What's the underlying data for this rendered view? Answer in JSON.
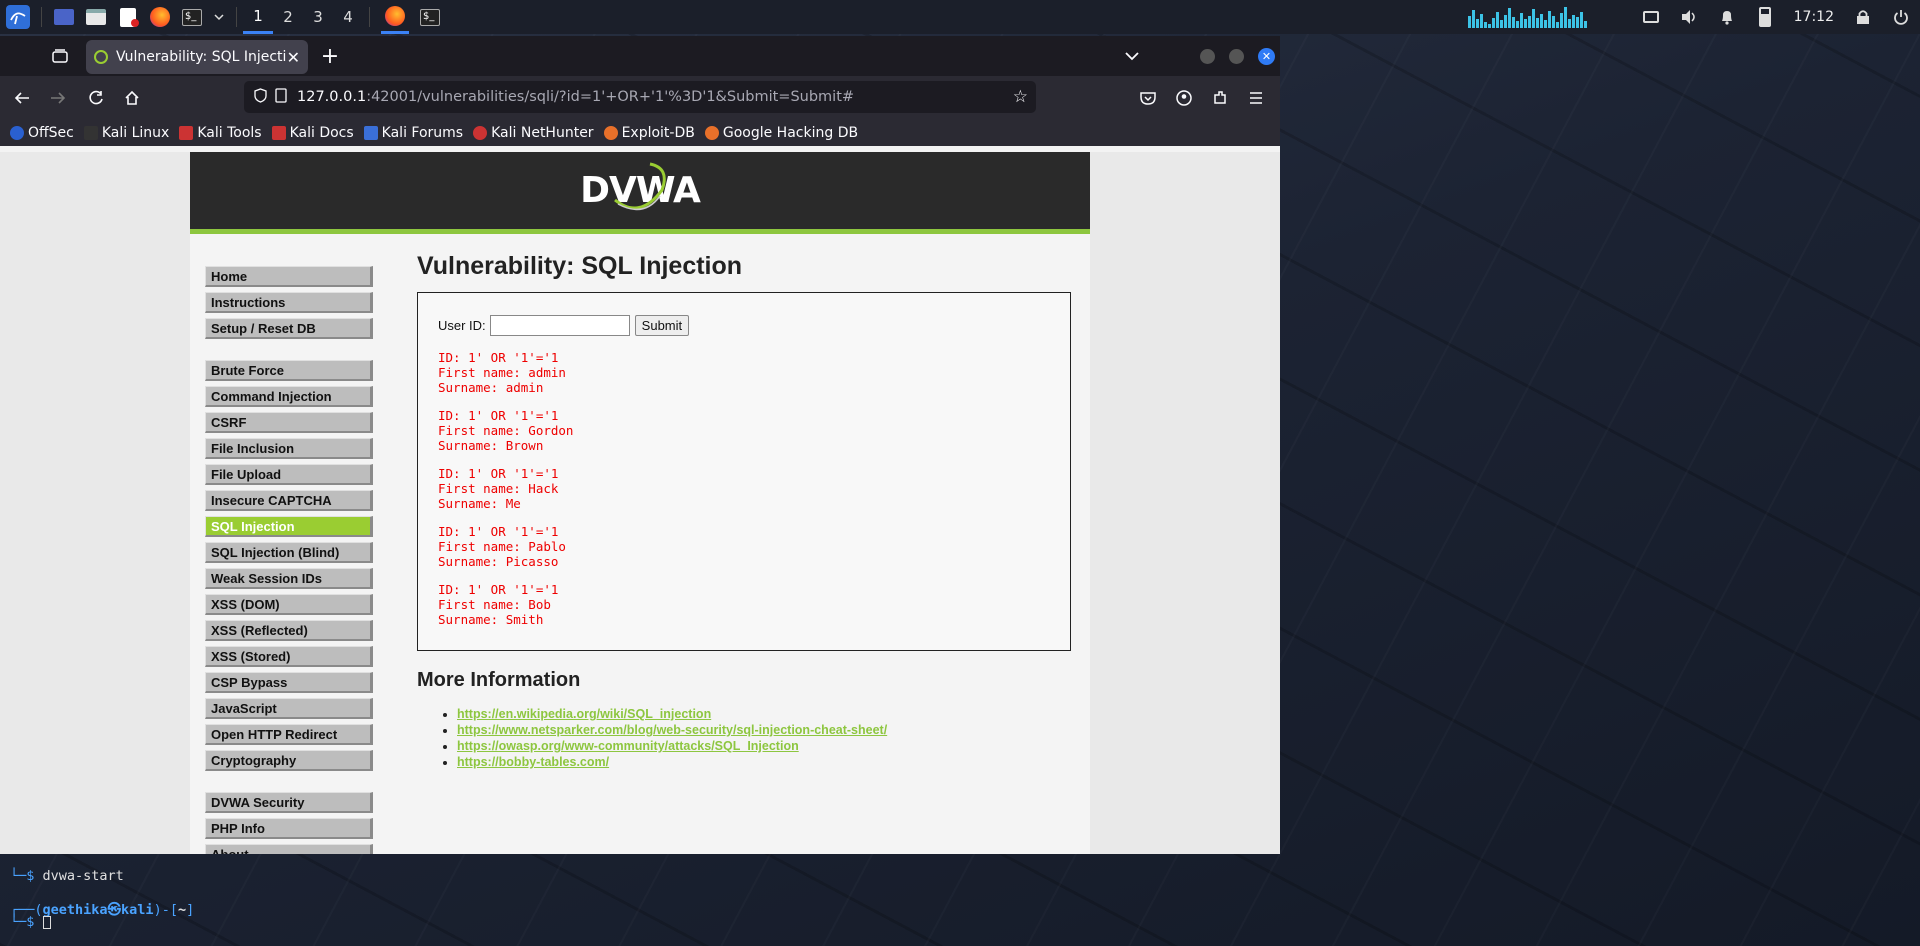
{
  "panel": {
    "workspaces": [
      "1",
      "2",
      "3",
      "4"
    ],
    "active_workspace": "1",
    "clock": "17:12"
  },
  "browser": {
    "tab_title": "Vulnerability: SQL Injection",
    "url_host": "127.0.0.1",
    "url_rest": ":42001/vulnerabilities/sqli/?id=1'+OR+'1'%3D'1&Submit=Submit#",
    "bookmarks": [
      "OffSec",
      "Kali Linux",
      "Kali Tools",
      "Kali Docs",
      "Kali Forums",
      "Kali NetHunter",
      "Exploit-DB",
      "Google Hacking DB"
    ]
  },
  "dvwa": {
    "logo": "DVWA",
    "menu_group1": [
      "Home",
      "Instructions",
      "Setup / Reset DB"
    ],
    "menu_group2": [
      "Brute Force",
      "Command Injection",
      "CSRF",
      "File Inclusion",
      "File Upload",
      "Insecure CAPTCHA",
      "SQL Injection",
      "SQL Injection (Blind)",
      "Weak Session IDs",
      "XSS (DOM)",
      "XSS (Reflected)",
      "XSS (Stored)",
      "CSP Bypass",
      "JavaScript",
      "Open HTTP Redirect",
      "Cryptography"
    ],
    "menu_group3": [
      "DVWA Security",
      "PHP Info",
      "About"
    ],
    "selected_menu": "SQL Injection",
    "title": "Vulnerability: SQL Injection",
    "user_id_label": "User ID:",
    "user_id_value": "",
    "submit_label": "Submit",
    "results": [
      {
        "id": "ID: 1' OR '1'='1",
        "first": "First name: admin",
        "surname": "Surname: admin"
      },
      {
        "id": "ID: 1' OR '1'='1",
        "first": "First name: Gordon",
        "surname": "Surname: Brown"
      },
      {
        "id": "ID: 1' OR '1'='1",
        "first": "First name: Hack",
        "surname": "Surname: Me"
      },
      {
        "id": "ID: 1' OR '1'='1",
        "first": "First name: Pablo",
        "surname": "Surname: Picasso"
      },
      {
        "id": "ID: 1' OR '1'='1",
        "first": "First name: Bob",
        "surname": "Surname: Smith"
      }
    ],
    "more_info_title": "More Information",
    "links": [
      "https://en.wikipedia.org/wiki/SQL_injection",
      "https://www.netsparker.com/blog/web-security/sql-injection-cheat-sheet/",
      "https://owasp.org/www-community/attacks/SQL_Injection",
      "https://bobby-tables.com/"
    ]
  },
  "terminal": {
    "line1_prompt": "└─$ ",
    "line1_cmd": "dvwa-start",
    "line2_user": "geethika㉿kali",
    "line2_dir": "~",
    "line3_prompt": "└─$ "
  }
}
